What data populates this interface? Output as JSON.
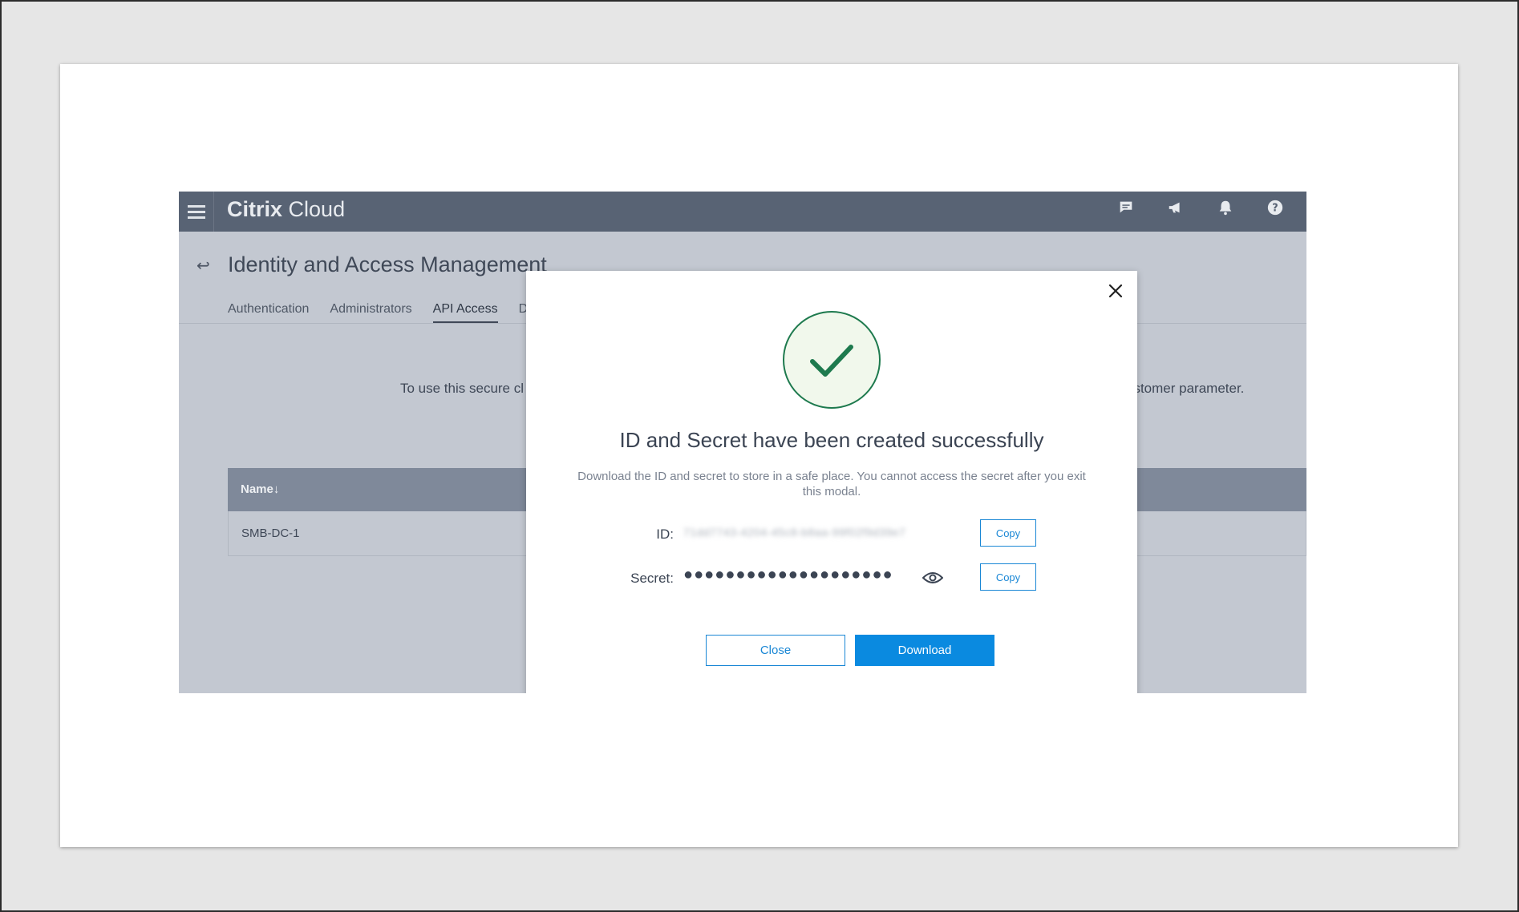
{
  "header": {
    "brand_bold": "Citrix",
    "brand_light": "Cloud",
    "icons": [
      "chat-icon",
      "megaphone-icon",
      "bell-icon",
      "help-icon"
    ]
  },
  "page": {
    "title": "Identity and Access Management",
    "tabs": [
      {
        "label": "Authentication",
        "active": false
      },
      {
        "label": "Administrators",
        "active": false
      },
      {
        "label": "API Access",
        "active": true
      },
      {
        "label": "Do",
        "active": false
      }
    ],
    "bg_text_left": "To use this secure cl",
    "bg_text_right": "ustomer parameter.",
    "table": {
      "header": "Name↓",
      "rows": [
        "SMB-DC-1"
      ]
    }
  },
  "modal": {
    "title": "ID and Secret have been created successfully",
    "description": "Download the ID and secret to store in a safe place. You cannot access the secret after you exit this modal.",
    "id_label": "ID:",
    "id_value": "71dd7743-4204-45c8-b8aa-99f02f9d39e7",
    "secret_label": "Secret:",
    "secret_value": "●●●●●●●●●●●●●●●●●●●●",
    "copy_label": "Copy",
    "close_label": "Close",
    "download_label": "Download"
  },
  "colors": {
    "accent": "#0a8ae0",
    "success": "#1e7a4e",
    "topbar": "#586374"
  }
}
